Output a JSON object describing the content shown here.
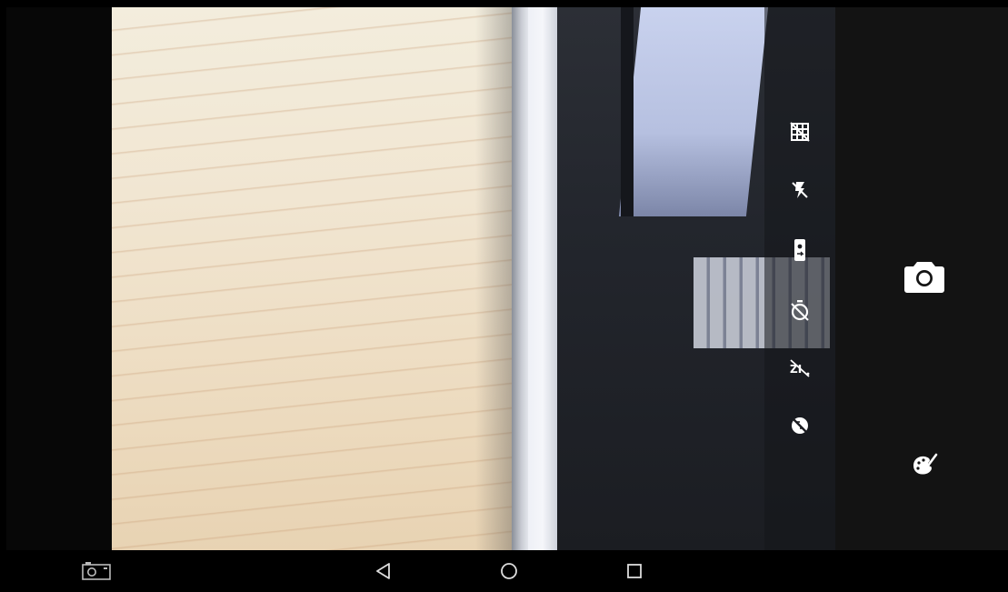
{
  "app": {
    "name": "Camera"
  },
  "viewfinder": {
    "description_free": true
  },
  "settings": {
    "items": [
      {
        "icon": "grid-off-icon"
      },
      {
        "icon": "flash-off-icon"
      },
      {
        "icon": "camera-switch-icon"
      },
      {
        "icon": "timer-off-icon"
      },
      {
        "icon": "hdr-off-icon"
      },
      {
        "icon": "exposure-off-icon"
      }
    ]
  },
  "controls": {
    "shutter_icon": "camera-icon",
    "filter_icon": "palette-icon"
  },
  "navbar": {
    "buttons": [
      {
        "icon": "screenshot-icon"
      },
      {
        "icon": "back-icon"
      },
      {
        "icon": "home-icon"
      },
      {
        "icon": "recents-icon"
      }
    ]
  },
  "colors": {
    "icon": "#ffffff",
    "rail": "#131313",
    "navbar": "#000000"
  }
}
